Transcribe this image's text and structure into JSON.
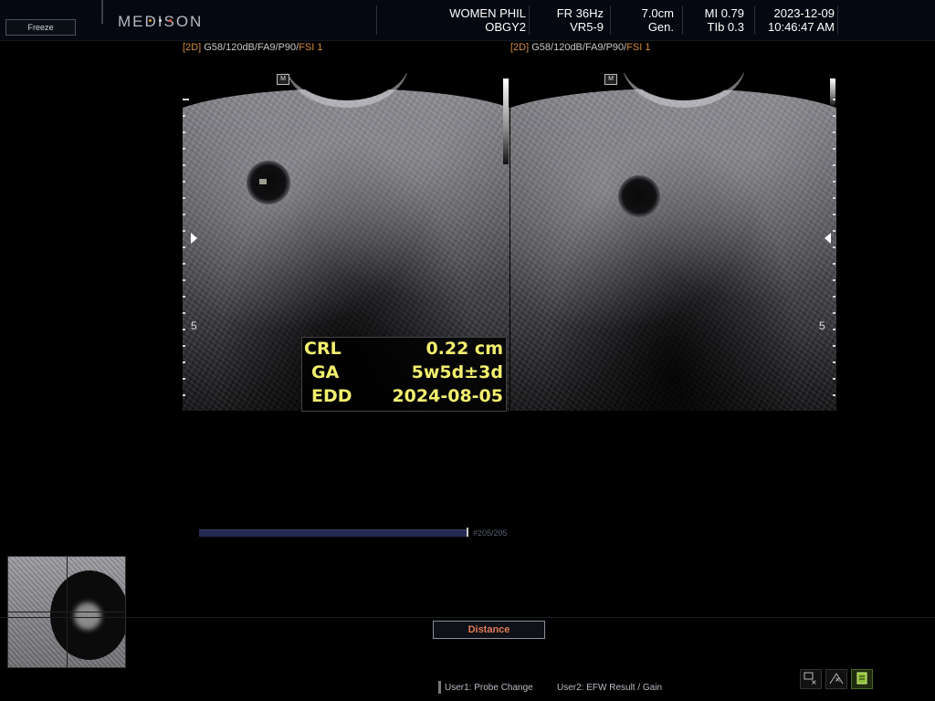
{
  "topbar": {
    "freeze_label": "Freeze",
    "logo_text": "MEDISON",
    "logo_dot_colors": [
      "#d8a23a",
      "#e0e0e0",
      "#e04a3a"
    ],
    "patient": {
      "name": "WOMEN PHIL",
      "preset": "OBGY2"
    },
    "frame": {
      "fr": "FR 36Hz",
      "probe": "VR5-9"
    },
    "depth": {
      "value": "7.0cm",
      "mode": "Gen."
    },
    "safety": {
      "mi": "MI 0.79",
      "tib": "TIb 0.3"
    },
    "datetime": {
      "date": "2023-12-09",
      "time": "10:46:47 AM"
    }
  },
  "images": [
    {
      "mode": "[2D]",
      "params": " G58/120dB/FA9/P90/",
      "fsi": "FSI 1",
      "depth_label": "5",
      "probe_mark": "M"
    },
    {
      "mode": "[2D]",
      "params": " G58/120dB/FA9/P90/",
      "fsi": "FSI 1",
      "depth_label": "5",
      "probe_mark": "M"
    }
  ],
  "measurement": {
    "rows": [
      {
        "key": "CRL",
        "value": "0.22 cm"
      },
      {
        "key": "GA",
        "value": "5w5d±3d"
      },
      {
        "key": "EDD",
        "value": "2024-08-05"
      }
    ]
  },
  "cine": {
    "label": "#205/205",
    "progress": 1.0
  },
  "bottom": {
    "active_tool": "Distance",
    "user1": "User1: Probe Change",
    "user2": "User2: EFW Result / Gain"
  },
  "icons": [
    "measure-cross-icon",
    "measure-angle-icon",
    "report-icon"
  ]
}
